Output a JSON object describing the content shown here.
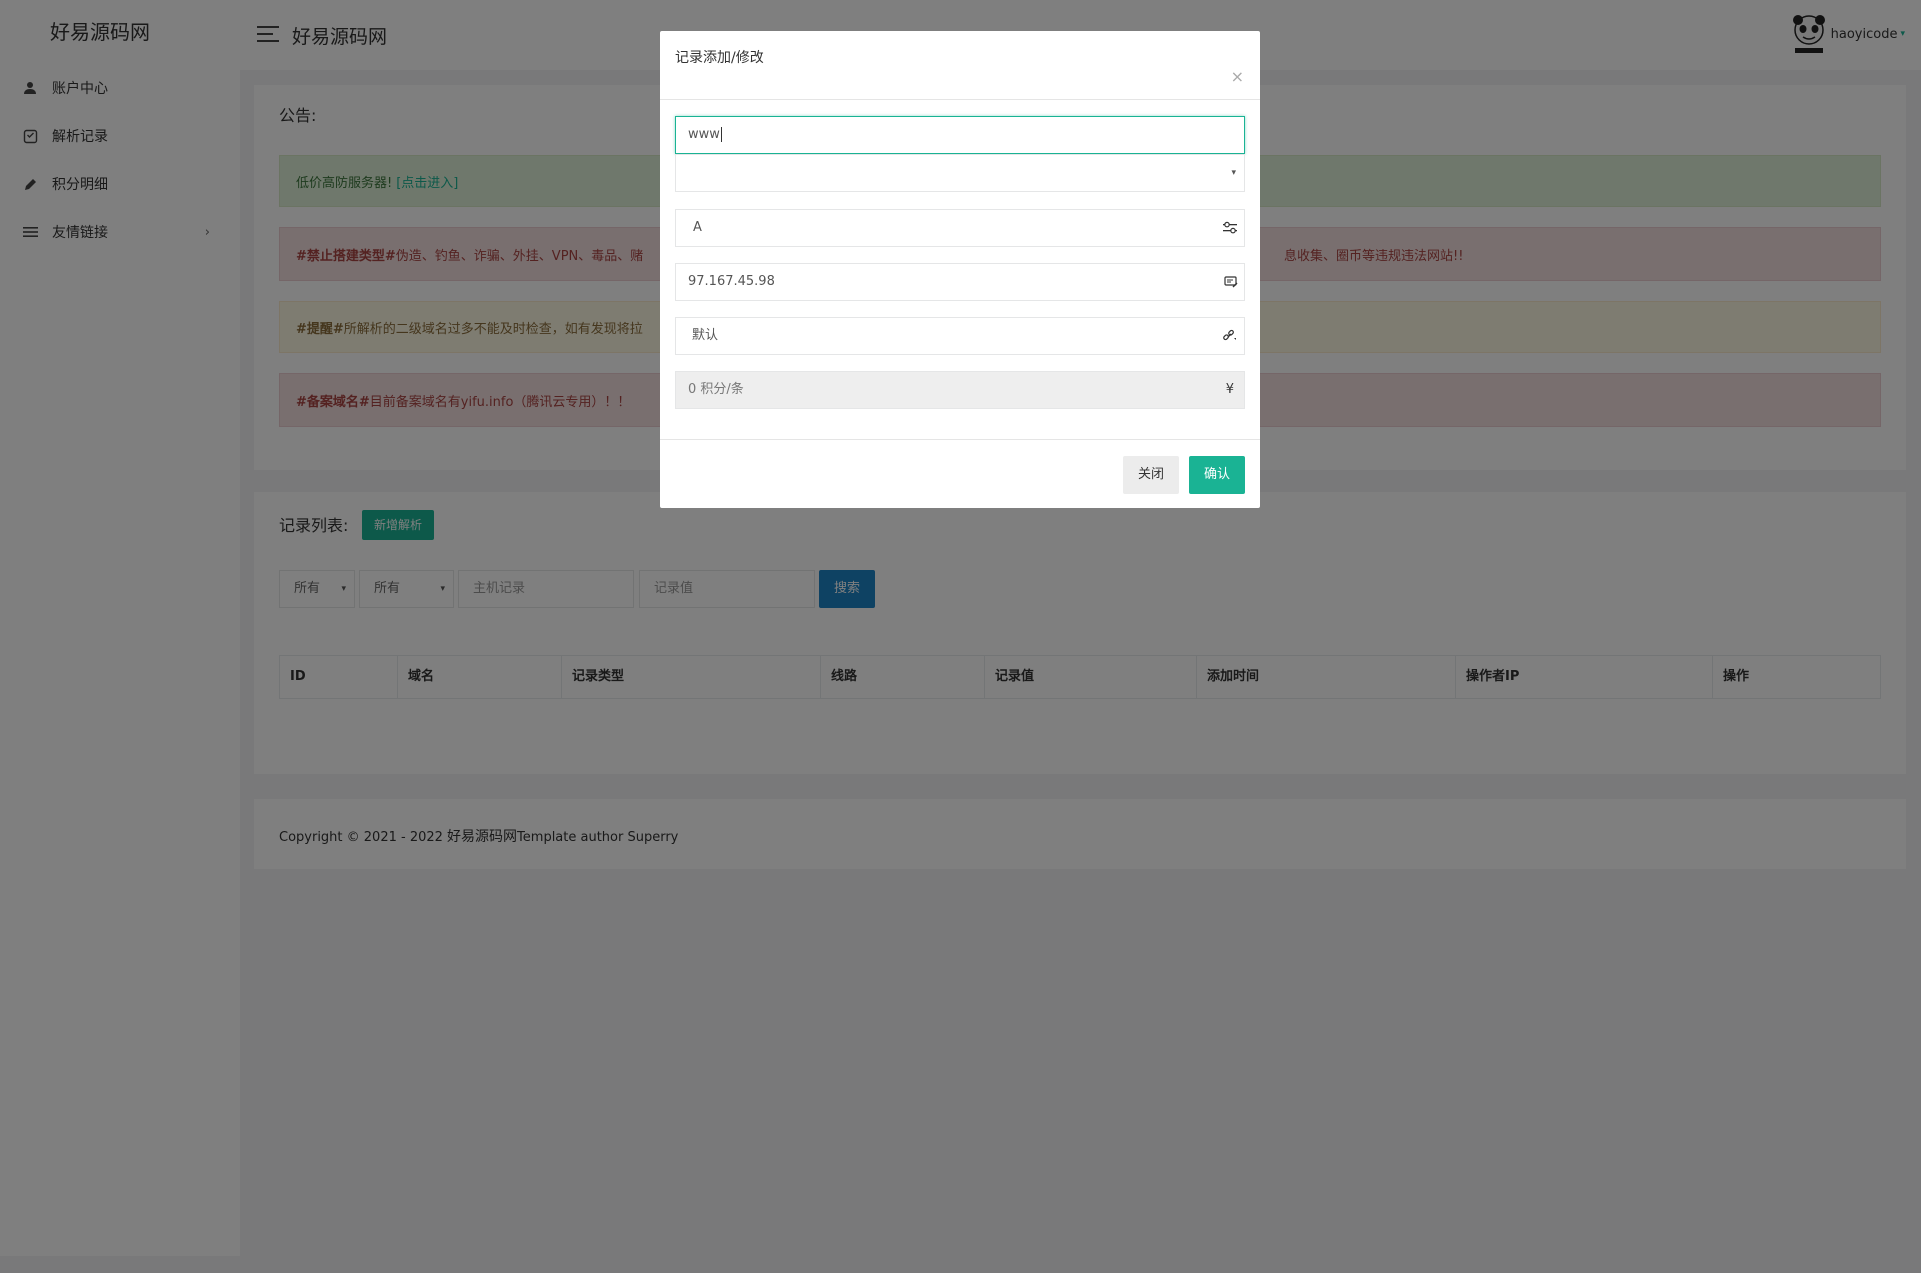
{
  "sidebar": {
    "brand": "好易源码网",
    "items": [
      {
        "label": "账户中心",
        "icon": "user-icon"
      },
      {
        "label": "解析记录",
        "icon": "record-icon"
      },
      {
        "label": "积分明细",
        "icon": "pencil-icon"
      },
      {
        "label": "友情链接",
        "icon": "list-icon",
        "arrow": "›"
      }
    ]
  },
  "header": {
    "title": "好易源码网",
    "username": "haoyicode",
    "caret": "▾"
  },
  "notice": {
    "title": "公告:",
    "alerts": [
      {
        "text": "低价高防服务器!",
        "link": "[点击进入]"
      },
      {
        "bold": "#禁止搭建类型#",
        "text": " 伪造、钓鱼、诈骗、外挂、VPN、毒品、赌",
        "text_right": "息收集、圈币等违规违法网站!!"
      },
      {
        "bold": "#提醒#",
        "text": " 所解析的二级域名过多不能及时检查，如有发现将拉"
      },
      {
        "bold": "#备案域名#",
        "text": " 目前备案域名有yifu.info（腾讯云专用）！！"
      }
    ]
  },
  "records": {
    "title": "记录列表:",
    "add_button": "新增解析",
    "filters": {
      "type_value": "所有",
      "line_value": "所有",
      "host_placeholder": "主机记录",
      "value_placeholder": "记录值",
      "dropdown_glyph": "▾"
    },
    "search_button": "搜索",
    "columns": [
      "ID",
      "域名",
      "记录类型",
      "线路",
      "记录值",
      "添加时间",
      "操作者IP",
      "操作"
    ]
  },
  "footer": {
    "text": "Copyright © 2021 - 2022 ",
    "brand": "好易源码网",
    "suffix": "Template author Superry"
  },
  "modal": {
    "title": "记录添加/修改",
    "close_glyph": "×",
    "host_value": "www",
    "domain_value": "",
    "record_type": "A",
    "record_value": "97.167.45.98",
    "line": "默认",
    "cost": "0 积分/条",
    "currency_glyph": "¥",
    "close_button": "关闭",
    "confirm_button": "确认"
  }
}
